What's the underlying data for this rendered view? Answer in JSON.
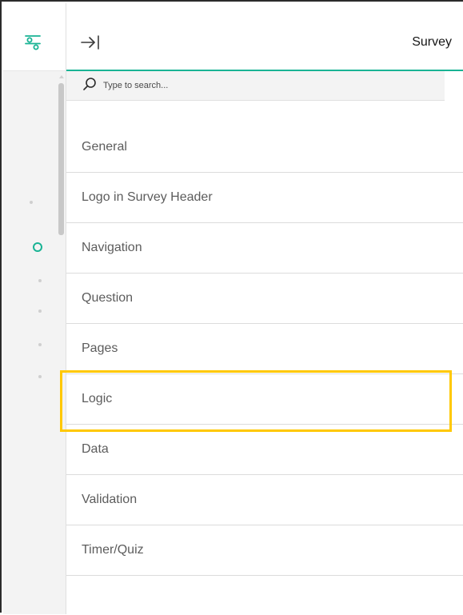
{
  "header": {
    "title": "Survey"
  },
  "search": {
    "placeholder": "Type to search..."
  },
  "categories": [
    {
      "label": "General"
    },
    {
      "label": "Logo in Survey Header"
    },
    {
      "label": "Navigation"
    },
    {
      "label": "Question"
    },
    {
      "label": "Pages"
    },
    {
      "label": "Logic"
    },
    {
      "label": "Data"
    },
    {
      "label": "Validation"
    },
    {
      "label": "Timer/Quiz"
    }
  ],
  "colors": {
    "accent": "#19b394",
    "highlight": "#ffc800"
  },
  "icons": {
    "settings": "settings-sliders-icon",
    "collapse": "collapse-panel-icon",
    "search": "search-icon"
  }
}
